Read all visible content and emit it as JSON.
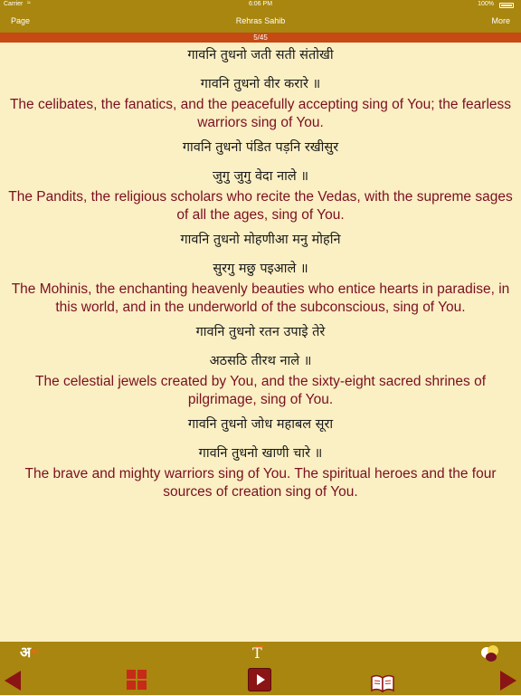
{
  "status_bar": {
    "carrier": "Carrier",
    "wifi_icon": "wifi-icon",
    "time": "6:06 PM",
    "battery": "100%",
    "battery_icon": "battery-icon"
  },
  "nav": {
    "page_label": "Page",
    "title": "Rehras Sahib",
    "more_label": "More"
  },
  "progress": "5/45",
  "verses": [
    {
      "lines": [
        "गावनि तुधनो जती सती संतोखी",
        "गावनि तुधनो वीर करारे ॥"
      ],
      "translation": "The celibates, the fanatics, and the peacefully accepting sing of You; the fearless warriors sing of You."
    },
    {
      "lines": [
        "गावनि तुधनो पंडित पड़नि रखीसुर",
        "जुगु जुगु वेदा नाले ॥"
      ],
      "translation": "The Pandits, the religious scholars who recite the Vedas, with the supreme sages of all the ages, sing of You."
    },
    {
      "lines": [
        "गावनि तुधनो मोहणीआ मनु मोहनि",
        "सुरगु मछु पइआले ॥"
      ],
      "translation": "The Mohinis, the enchanting heavenly beauties who entice hearts in paradise, in this world, and in the underworld of the subconscious, sing of You."
    },
    {
      "lines": [
        "गावनि तुधनो रतन उपाइे तेरे",
        "अठसठि तीरथ नाले ॥"
      ],
      "translation": "The celestial jewels created by You, and the sixty-eight sacred shrines of pilgrimage, sing of You."
    },
    {
      "lines": [
        "गावनि तुधनो जोध महाबल सूरा",
        "गावनि तुधनो खाणी चारे ॥"
      ],
      "translation": "The brave and mighty warriors sing of You. The spiritual heroes and the four sources of creation sing of You."
    }
  ],
  "toolbar": {
    "language_glyph": "अ",
    "language_superscript": "ਅ",
    "text_size_glyph": "T",
    "icons": [
      "language-icon",
      "text-size-icon",
      "color-theme-icon",
      "previous-arrow-icon",
      "grid-icon",
      "play-icon",
      "book-icon",
      "next-arrow-icon"
    ],
    "colors": {
      "bar": "#a8860f",
      "accent": "#8b1414",
      "grid": "#c62a18"
    }
  },
  "colors": {
    "background": "#fbefc4",
    "translation_text": "#7a1020",
    "progress_strip": "#c54a13"
  }
}
